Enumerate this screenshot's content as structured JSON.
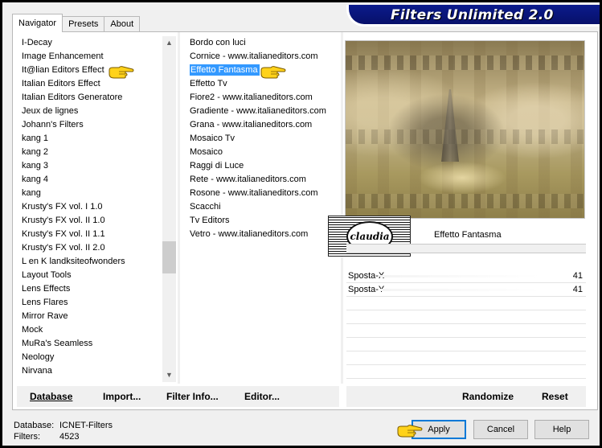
{
  "window": {
    "title": "Filters Unlimited 2.0"
  },
  "tabs": [
    {
      "label": "Navigator",
      "active": true
    },
    {
      "label": "Presets",
      "active": false
    },
    {
      "label": "About",
      "active": false
    }
  ],
  "categories": [
    "I-Decay",
    "Image Enhancement",
    "It@lian Editors Effect",
    "Italian Editors Effect",
    "Italian Editors Generatore",
    "Jeux de lignes",
    "Johann's Filters",
    "kang 1",
    "kang 2",
    "kang 3",
    "kang 4",
    "kang",
    "Krusty's FX vol. I 1.0",
    "Krusty's FX vol. II 1.0",
    "Krusty's FX vol. II 1.1",
    "Krusty's FX vol. II 2.0",
    "L en K landksiteofwonders",
    "Layout Tools",
    "Lens Effects",
    "Lens Flares",
    "Mirror Rave",
    "Mock",
    "MuRa's Seamless",
    "Neology",
    "Nirvana"
  ],
  "filters": {
    "selected_index": 2,
    "items": [
      "Bordo con luci",
      "Cornice - www.italianeditors.com",
      "Effetto Fantasma",
      "Effetto Tv",
      "Fiore2 - www.italianeditors.com",
      "Gradiente - www.italianeditors.com",
      "Grana - www.italianeditors.com",
      "Mosaico Tv",
      "Mosaico",
      "Raggi di Luce",
      "Rete - www.italianeditors.com",
      "Rosone - www.italianeditors.com",
      "Scacchi",
      "Tv Editors",
      "Vetro - www.italianeditors.com"
    ]
  },
  "effect": {
    "name": "Effetto Fantasma",
    "watermark": "claudia",
    "params": [
      {
        "name": "Sposta-X",
        "value": "41"
      },
      {
        "name": "Sposta-Y",
        "value": "41"
      }
    ]
  },
  "left_buttons": {
    "database": "Database",
    "import": "Import...",
    "filter_info": "Filter Info...",
    "editor": "Editor..."
  },
  "right_buttons": {
    "randomize": "Randomize",
    "reset": "Reset"
  },
  "info": {
    "database_label": "Database:",
    "database_value": "ICNET-Filters",
    "filters_label": "Filters:",
    "filters_value": "4523"
  },
  "dialog_buttons": {
    "apply": "Apply",
    "cancel": "Cancel",
    "help": "Help"
  },
  "colors": {
    "banner": "#0b1b8c",
    "selection": "#3399ff",
    "hand_pointer": "#ffd21a"
  }
}
